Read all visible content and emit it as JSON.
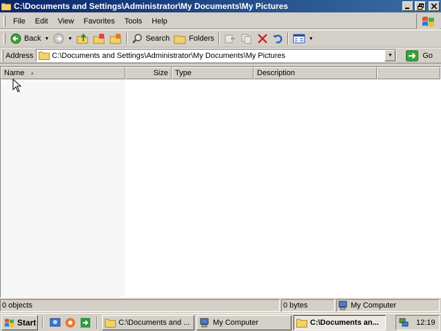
{
  "window": {
    "title": "C:\\Documents and Settings\\Administrator\\My Documents\\My Pictures",
    "controls": {
      "minimize": "_",
      "maximize": "❒",
      "close": "✕"
    }
  },
  "menu": {
    "items": [
      {
        "key": "F",
        "rest": "ile"
      },
      {
        "key": "E",
        "rest": "dit"
      },
      {
        "key": "V",
        "rest": "iew"
      },
      {
        "key": "",
        "prefix": "F",
        "key2": "a",
        "rest": "vorites"
      },
      {
        "key": "T",
        "rest": "ools"
      },
      {
        "key": "H",
        "rest": "elp"
      }
    ],
    "labels": [
      "File",
      "Edit",
      "View",
      "Favorites",
      "Tools",
      "Help"
    ]
  },
  "toolbar": {
    "back_label": "Back",
    "search_label": "Search",
    "folders_label": "Folders"
  },
  "address": {
    "label": "Address",
    "value": "C:\\Documents and Settings\\Administrator\\My Documents\\My Pictures",
    "go_label": "Go"
  },
  "list": {
    "columns": [
      "Name",
      "Size",
      "Type",
      "Description"
    ],
    "rows": []
  },
  "status": {
    "objects": "0 objects",
    "bytes": "0 bytes",
    "zone": "My Computer"
  },
  "taskbar": {
    "start_label": "Start",
    "tasks": [
      {
        "label": "C:\\Documents and ...",
        "active": false
      },
      {
        "label": "My Computer",
        "active": false
      },
      {
        "label": "C:\\Documents an...",
        "active": true
      }
    ],
    "clock": "12:19"
  },
  "colors": {
    "titlebar_start": "#0a246a",
    "titlebar_end": "#3a6ea5",
    "face": "#d4d0c8"
  }
}
